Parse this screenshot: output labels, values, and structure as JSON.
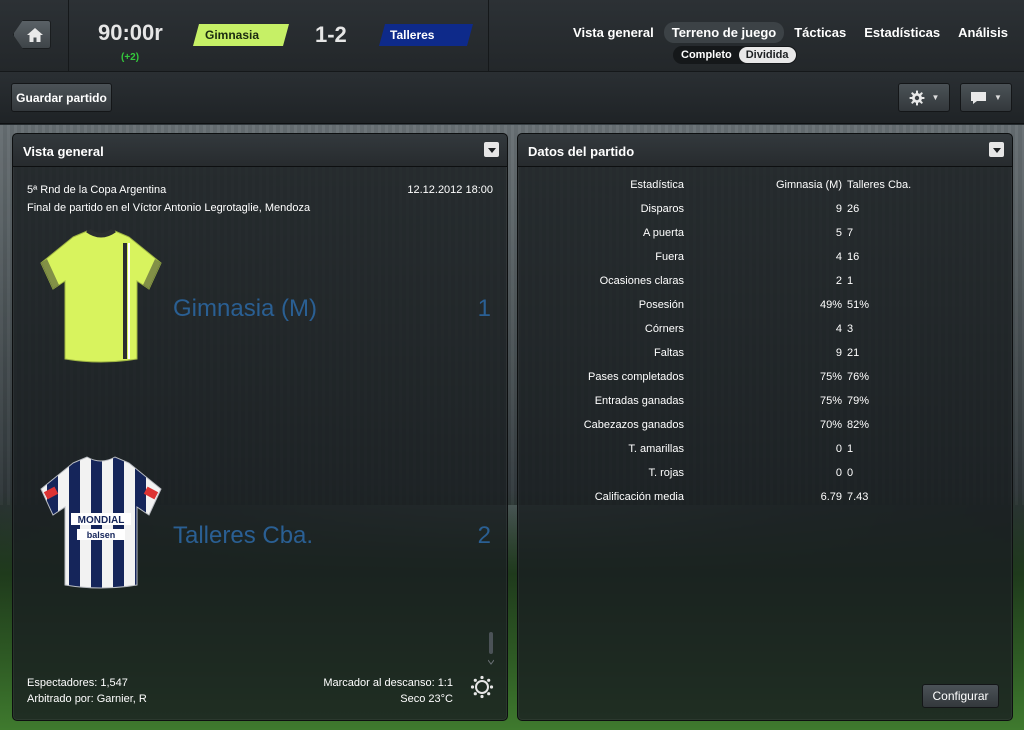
{
  "header": {
    "clock": "90:00r",
    "added_time": "(+2)",
    "home_team": "Gimnasia (M)",
    "away_team": "Talleres Cba.",
    "score": "1-2",
    "home_color": "#c6f066",
    "away_color": "#0e2a8a",
    "nav_tabs": [
      {
        "label": "Vista general"
      },
      {
        "label": "Terreno de juego"
      },
      {
        "label": "Tácticas"
      },
      {
        "label": "Estadísticas"
      },
      {
        "label": "Análisis"
      }
    ],
    "sub_tabs": [
      {
        "label": "Completo"
      },
      {
        "label": "Dividida"
      }
    ]
  },
  "toolbar": {
    "save_label": "Guardar partido",
    "gear_icon": "gear-icon",
    "chat_icon": "chat-bubble-icon"
  },
  "overview": {
    "title": "Vista general",
    "competition": "5ª Rnd de la Copa Argentina",
    "datetime": "12.12.2012 18:00",
    "venue": "Final de partido en el Víctor Antonio Legrotaglie, Mendoza",
    "home_name": "Gimnasia (M)",
    "home_goals": "1",
    "away_name": "Talleres Cba.",
    "away_goals": "2",
    "home_kit_sponsor": "",
    "away_kit_sponsor_top": "MONDIAL",
    "away_kit_sponsor_bottom": "balsen",
    "attendance": "Espectadores: 1,547",
    "referee": "Arbitrado por: Garnier, R",
    "halftime": "Marcador al descanso: 1:1",
    "weather": "Seco 23°C"
  },
  "stats": {
    "title": "Datos del partido",
    "header": {
      "label": "Estadística",
      "home": "Gimnasia (M)",
      "away": "Talleres Cba."
    },
    "rows": [
      {
        "label": "Disparos",
        "home": "9",
        "away": "26"
      },
      {
        "label": "A puerta",
        "home": "5",
        "away": "7"
      },
      {
        "label": "Fuera",
        "home": "4",
        "away": "16"
      },
      {
        "label": "Ocasiones claras",
        "home": "2",
        "away": "1"
      },
      {
        "label": "Posesión",
        "home": "49%",
        "away": "51%"
      },
      {
        "label": "Córners",
        "home": "4",
        "away": "3"
      },
      {
        "label": "Faltas",
        "home": "9",
        "away": "21"
      },
      {
        "label": "Pases completados",
        "home": "75%",
        "away": "76%"
      },
      {
        "label": "Entradas ganadas",
        "home": "75%",
        "away": "79%"
      },
      {
        "label": "Cabezazos ganados",
        "home": "70%",
        "away": "82%"
      },
      {
        "label": "T. amarillas",
        "home": "0",
        "away": "1"
      },
      {
        "label": "T. rojas",
        "home": "0",
        "away": "0"
      },
      {
        "label": "Calificación media",
        "home": "6.79",
        "away": "7.43"
      }
    ],
    "configure_label": "Configurar"
  }
}
